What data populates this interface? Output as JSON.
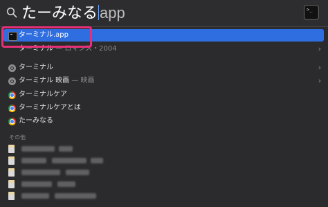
{
  "search": {
    "query_typed": "たーみなる",
    "completion": "app"
  },
  "results": [
    {
      "label": "ターミナル.app",
      "meta": "",
      "icon": "terminal-icon",
      "selected": true,
      "chevron": false
    },
    {
      "label": "ターミナル",
      "meta": "— ロマンス・2004",
      "icon": "",
      "selected": false,
      "chevron": true
    },
    {
      "label": "ターミナル",
      "meta": "",
      "icon": "search-icon",
      "selected": false,
      "chevron": true
    },
    {
      "label": "ターミナル 映画",
      "meta": "— 映画",
      "icon": "search-icon",
      "selected": false,
      "chevron": true
    },
    {
      "label": "ターミナルケア",
      "meta": "",
      "icon": "chrome-icon",
      "selected": false,
      "chevron": false
    },
    {
      "label": "ターミナルケアとは",
      "meta": "",
      "icon": "chrome-icon",
      "selected": false,
      "chevron": false
    },
    {
      "label": "たーみなる",
      "meta": "",
      "icon": "chrome-icon",
      "selected": false,
      "chevron": false
    }
  ],
  "others": {
    "header": "その他"
  },
  "colors": {
    "selection": "#2f6ee0",
    "annotation": "#e8307a"
  }
}
